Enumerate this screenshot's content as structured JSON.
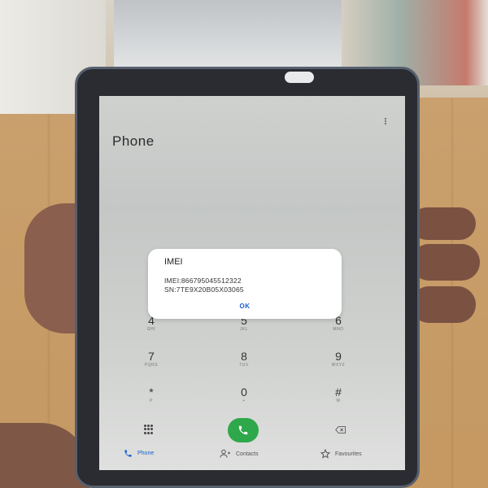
{
  "app": {
    "title": "Phone"
  },
  "dialog": {
    "title": "IMEI",
    "imei_line": "IMEI:866795045512322",
    "sn_line": "SN:7TE9X20B05X03065",
    "ok_label": "OK"
  },
  "dialpad": {
    "keys": [
      {
        "digit": "4",
        "letters": "GHI"
      },
      {
        "digit": "5",
        "letters": "JKL"
      },
      {
        "digit": "6",
        "letters": "MNO"
      },
      {
        "digit": "7",
        "letters": "PQRS"
      },
      {
        "digit": "8",
        "letters": "TUV"
      },
      {
        "digit": "9",
        "letters": "WXYZ"
      },
      {
        "digit": "*",
        "letters": "P"
      },
      {
        "digit": "0",
        "letters": "+"
      },
      {
        "digit": "#",
        "letters": "W"
      }
    ]
  },
  "nav": {
    "phone": "Phone",
    "contacts": "Contacts",
    "favourites": "Favourites"
  },
  "colors": {
    "call_button": "#2ea84a",
    "accent": "#1a5fd1"
  }
}
